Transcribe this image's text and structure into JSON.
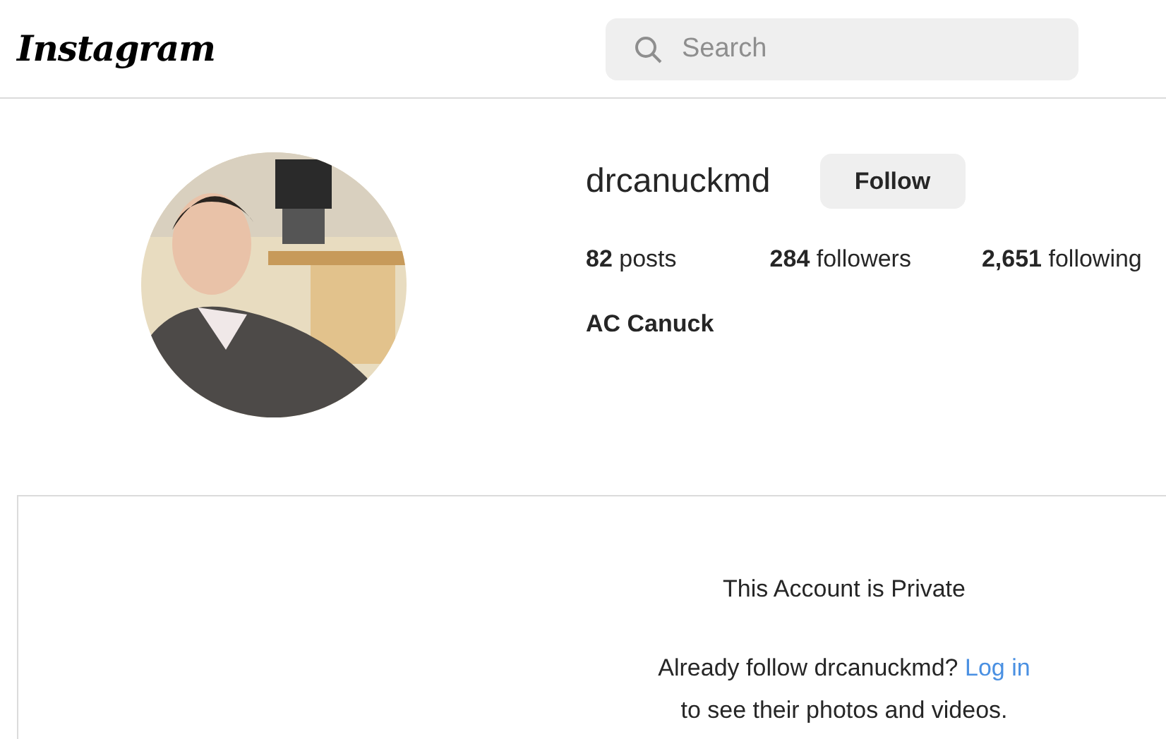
{
  "header": {
    "logo": "Instagram",
    "search": {
      "placeholder": "Search"
    }
  },
  "profile": {
    "username": "drcanuckmd",
    "follow_button": "Follow",
    "stats": [
      "**82** posts",
      "**284** followers",
      "**2,651** following"
    ],
    "full_name": "AC Canuck"
  },
  "private_notice": {
    "title": "This Account is Private",
    "line_1": "Already follow drcanuckmd?",
    "link": "Log in",
    "line_2": "to see their photos and videos."
  }
}
